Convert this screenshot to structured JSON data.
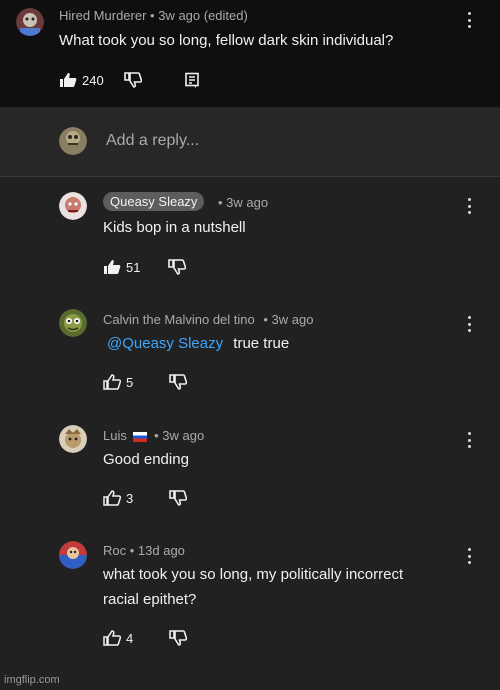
{
  "top_comment": {
    "author": "Hired Murderer",
    "meta": "• 3w ago (edited)",
    "text": "What took you so long, fellow dark skin individual?",
    "likes": "240"
  },
  "reply_box": {
    "placeholder": "Add a reply..."
  },
  "replies": [
    {
      "author": "Queasy Sleazy",
      "meta": "• 3w ago",
      "text": "Kids bop in a nutshell",
      "likes": "51"
    },
    {
      "author": "Calvin the Malvino del tino",
      "meta": "• 3w ago",
      "mention": "@Queasy Sleazy",
      "text": "true true",
      "likes": "5"
    },
    {
      "author": "Luis",
      "meta": "• 3w ago",
      "text": "Good ending",
      "likes": "3"
    },
    {
      "author": "Roc",
      "meta": "• 13d ago",
      "text_line1": "what took you so long, my politically incorrect",
      "text_line2": "racial epithet?",
      "likes": "4"
    }
  ],
  "watermark": "imgflip.com",
  "colors": {
    "background": "#212121",
    "top_background": "#0f0f0f",
    "mention": "#3ea6ff",
    "chip": "#5d5d5d"
  },
  "icons": [
    "like-filled-icon",
    "like-outline-icon",
    "dislike-icon",
    "reply-icon",
    "more-icon"
  ]
}
